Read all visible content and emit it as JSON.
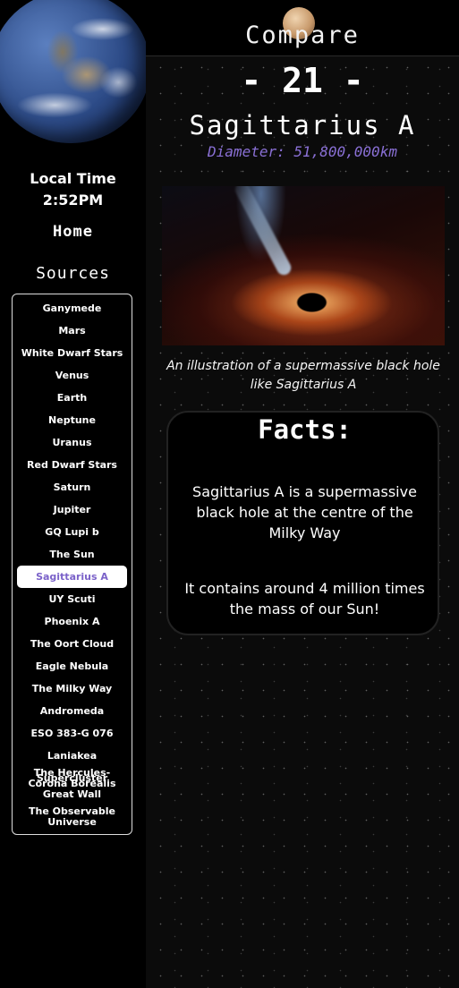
{
  "sidebar": {
    "local_time_label": "Local Time",
    "local_time_value": "2:52PM",
    "home_label": "Home",
    "sources_label": "Sources",
    "items": [
      {
        "label": "Ganymede"
      },
      {
        "label": "Mars"
      },
      {
        "label": "White Dwarf Stars"
      },
      {
        "label": "Venus"
      },
      {
        "label": "Earth"
      },
      {
        "label": "Neptune"
      },
      {
        "label": "Uranus"
      },
      {
        "label": "Red Dwarf Stars"
      },
      {
        "label": "Saturn"
      },
      {
        "label": "Jupiter"
      },
      {
        "label": "GQ Lupi b"
      },
      {
        "label": "The Sun"
      },
      {
        "label": "Sagittarius A",
        "active": true
      },
      {
        "label": "UY Scuti"
      },
      {
        "label": "Phoenix A"
      },
      {
        "label": "The Oort Cloud"
      },
      {
        "label": "Eagle Nebula"
      },
      {
        "label": "The Milky Way"
      },
      {
        "label": "Andromeda"
      },
      {
        "label": "ESO 383-G 076"
      },
      {
        "label": "Laniakea Supercluster"
      },
      {
        "label": "The Hercules-Corona Borealis Great Wall"
      },
      {
        "label": "The Observable Universe"
      }
    ]
  },
  "header": {
    "title": "Compare"
  },
  "main": {
    "number": "- 21 -",
    "name": "Sagittarius A",
    "diameter": "Diameter: 51,800,000km",
    "caption": "An illustration of a supermassive black hole like Sagittarius A",
    "facts_title": "Facts:",
    "facts": [
      "Sagittarius A is a supermassive black hole at the centre of the Milky Way",
      "It contains around 4 million times the mass of our Sun!"
    ]
  },
  "colors": {
    "accent": "#8a70d6",
    "active_item_text": "#7b62c9"
  }
}
